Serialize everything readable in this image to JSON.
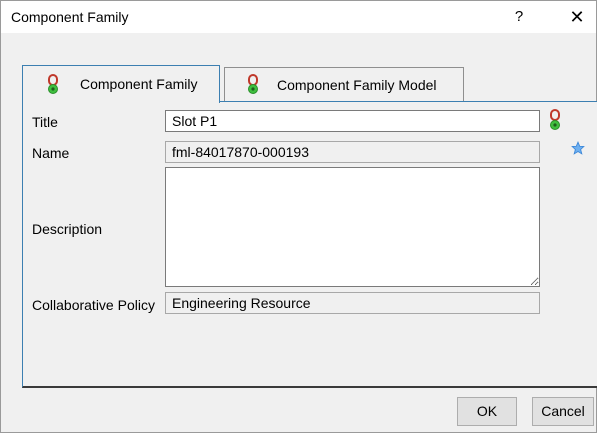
{
  "window": {
    "title": "Component Family",
    "help_label": "?",
    "close_label": "✕"
  },
  "tabs": [
    {
      "label": "Component Family",
      "active": true
    },
    {
      "label": "Component Family Model",
      "active": false
    }
  ],
  "form": {
    "title_label": "Title",
    "title_value": "Slot P1",
    "name_label": "Name",
    "name_value": "fml-84017870-000193",
    "description_label": "Description",
    "description_value": "",
    "policy_label": "Collaborative Policy",
    "policy_value": "Engineering Resource"
  },
  "buttons": {
    "ok_label": "OK",
    "cancel_label": "Cancel"
  },
  "colors": {
    "tab_accent": "#3c7fb1",
    "icon_green": "#3fbf3f",
    "icon_red": "#c0392b",
    "star_blue": "#3a86d8"
  }
}
